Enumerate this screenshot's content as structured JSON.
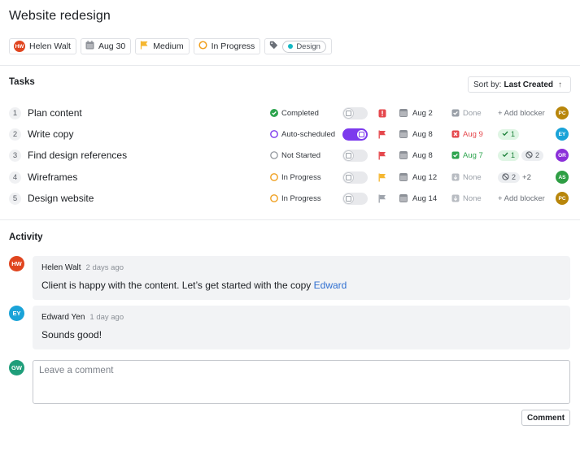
{
  "title": "Website redesign",
  "chips": {
    "assignee": {
      "initials": "HW",
      "name": "Helen Walt",
      "color": "#e0451f"
    },
    "due": "Aug 30",
    "priority": "Medium",
    "status": "In Progress",
    "tag": "Design"
  },
  "tasks_section": {
    "title": "Tasks",
    "sort_label": "Sort by:",
    "sort_value": "Last Created"
  },
  "tasks": [
    {
      "num": "1",
      "name": "Plan content",
      "status": "Completed",
      "status_kind": "completed",
      "auto": false,
      "priority": "urgent",
      "due": "Aug 2",
      "sub_icon": "check-box-grey-icon",
      "sub_label": "Done",
      "sub_color": "#9aa0a8",
      "blockers_kind": "add",
      "blockers": {
        "add": "+ Add blocker"
      },
      "assignee": {
        "initials": "PC",
        "color": "#b8860b"
      }
    },
    {
      "num": "2",
      "name": "Write copy",
      "status": "Auto-scheduled",
      "status_kind": "auto",
      "auto": true,
      "priority": "high",
      "due": "Aug 8",
      "sub_icon": "overdue-red-icon",
      "sub_label": "Aug 9",
      "sub_color": "#e5484d",
      "blockers_kind": "green",
      "blockers": {
        "green": "1"
      },
      "assignee": {
        "initials": "EY",
        "color": "#1aa3d8"
      }
    },
    {
      "num": "3",
      "name": "Find design references",
      "status": "Not Started",
      "status_kind": "not-started",
      "auto": false,
      "priority": "high",
      "due": "Aug 8",
      "sub_icon": "check-box-green-icon",
      "sub_label": "Aug 7",
      "sub_color": "#2da44e",
      "blockers_kind": "green-grey",
      "blockers": {
        "green": "1",
        "grey": "2"
      },
      "assignee": {
        "initials": "OR",
        "color": "#8b2fd9"
      }
    },
    {
      "num": "4",
      "name": "Wireframes",
      "status": "In Progress",
      "status_kind": "in-progress",
      "auto": false,
      "priority": "medium",
      "due": "Aug 12",
      "sub_icon": "none-icon",
      "sub_label": "None",
      "sub_color": "#9aa0a8",
      "blockers_kind": "grey-more",
      "blockers": {
        "grey": "2",
        "more": "+2"
      },
      "assignee": {
        "initials": "AS",
        "color": "#2e9e44"
      }
    },
    {
      "num": "5",
      "name": "Design website",
      "status": "In Progress",
      "status_kind": "in-progress",
      "auto": false,
      "priority": "low",
      "due": "Aug 14",
      "sub_icon": "none-icon",
      "sub_label": "None",
      "sub_color": "#9aa0a8",
      "blockers_kind": "add",
      "blockers": {
        "add": "+ Add blocker"
      },
      "assignee": {
        "initials": "PC",
        "color": "#b8860b"
      }
    }
  ],
  "activity": {
    "title": "Activity",
    "comments": [
      {
        "initials": "HW",
        "color": "#e0451f",
        "author": "Helen Walt",
        "time": "2 days ago",
        "body": "Client is happy with the content. Let’s get started with the copy ",
        "mention": "Edward"
      },
      {
        "initials": "EY",
        "color": "#1aa3d8",
        "author": "Edward Yen",
        "time": "1 day ago",
        "body": "Sounds good!",
        "mention": ""
      }
    ],
    "composer": {
      "initials": "GW",
      "color": "#1f9e7a",
      "placeholder": "Leave a comment",
      "button": "Comment"
    }
  },
  "colors": {
    "completed": "#2da44e",
    "auto": "#7c3aed",
    "in_progress": "#f0a020",
    "not_started": "#8b9097",
    "urgent": "#e5484d",
    "high": "#e5484d",
    "medium": "#f5b731",
    "low": "#a0a5ad"
  }
}
